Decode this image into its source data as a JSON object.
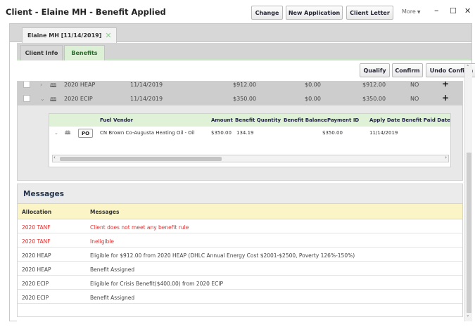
{
  "window": {
    "title": "Client - Elaine MH - Benefit Applied",
    "buttons": {
      "change": "Change",
      "new_application": "New Application",
      "client_letter": "Client Letter"
    },
    "more": "More",
    "minimize": "–",
    "maximize": "☐",
    "close": "✕"
  },
  "doc_tab": {
    "label": "Elaine MH [11/14/2019]",
    "close": "✕"
  },
  "sub_tabs": {
    "client_info": "Client Info",
    "benefits": "Benefits"
  },
  "actions": {
    "qualify": "Qualify",
    "confirm": "Confirm",
    "undo_confirm": "Undo Confirm"
  },
  "benefit_rows": [
    {
      "program": "2020 HEAP",
      "date": "11/14/2019",
      "amount": "$912.00",
      "balance": "$0.00",
      "amount2": "$912.00",
      "flag": "NO",
      "action": "+"
    },
    {
      "program": "2020 ECIP",
      "date": "11/14/2019",
      "amount": "$350.00",
      "balance": "$0.00",
      "amount2": "$350.00",
      "flag": "NO",
      "action": "+"
    }
  ],
  "vendor_table": {
    "headers": {
      "fuel_vendor": "Fuel Vendor",
      "amount": "Amount",
      "benefit_quantity": "Benefit Quantity",
      "benefit_balance": "Benefit Balance",
      "payment_id": "Payment ID",
      "apply_date": "Apply Date",
      "benefit_paid_date": "Benefit Paid Date"
    },
    "row": {
      "po": "PO",
      "fuel_vendor": "CN Brown Co-Augusta Heating Oil - Oil",
      "amount": "$350.00",
      "benefit_quantity": "134.19",
      "benefit_balance": "$350.00",
      "payment_id": "",
      "apply_date": "11/14/2019",
      "benefit_paid_date": ""
    }
  },
  "messages": {
    "title": "Messages",
    "headers": {
      "allocation": "Allocation",
      "messages": "Messages"
    },
    "rows": [
      {
        "allocation": "2020 TANF",
        "message": "Client does not meet any benefit rule"
      },
      {
        "allocation": "2020 TANF",
        "message": "Ineligible"
      },
      {
        "allocation": "2020 HEAP",
        "message": "Eligible for $912.00 from 2020 HEAP (DHLC Annual Energy Cost $2001-$2500, Poverty 126%-150%)"
      },
      {
        "allocation": "2020 HEAP",
        "message": "Benefit Assigned"
      },
      {
        "allocation": "2020 ECIP",
        "message": "Eligible for Crisis Benefit($400.00) from 2020 ECIP"
      },
      {
        "allocation": "2020 ECIP",
        "message": "Benefit Assigned"
      }
    ]
  },
  "colors": {
    "error_text": "#e03131",
    "active_tab": "#dcf0d6",
    "message_header": "#fbf4c7"
  }
}
